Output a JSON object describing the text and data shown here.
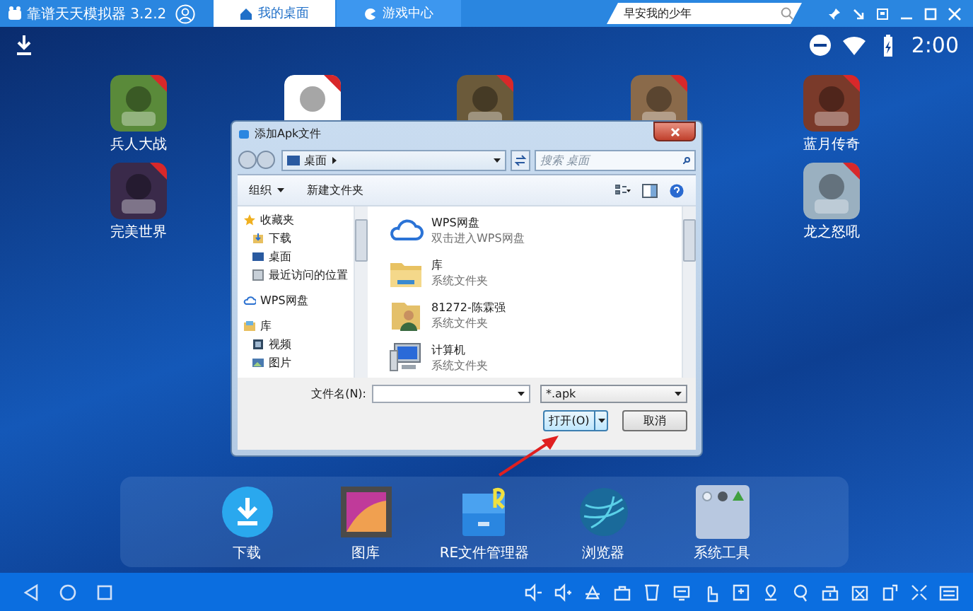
{
  "emulator": {
    "title": "靠谱天天模拟器 3.2.2",
    "tabs": [
      {
        "label": "我的桌面",
        "selected": true
      },
      {
        "label": "游戏中心",
        "selected": false
      }
    ],
    "search": {
      "value": "早安我的少年"
    }
  },
  "status_bar": {
    "time": "2:00"
  },
  "desktop_rows": [
    [
      {
        "label": "兵人大战"
      },
      {},
      {},
      {},
      {
        "label": "蓝月传奇"
      }
    ],
    [
      {
        "label": "完美世界"
      },
      {
        "label": "龙之怒吼"
      }
    ]
  ],
  "dialog": {
    "title": "添加Apk文件",
    "path": "桌面",
    "search_placeholder": "搜索 桌面",
    "toolbar": [
      "组织",
      "新建文件夹"
    ],
    "nav": [
      {
        "label": "收藏夹",
        "kind": "star",
        "children": [
          {
            "label": "下载",
            "kind": "download"
          },
          {
            "label": "桌面",
            "kind": "desktop"
          },
          {
            "label": "最近访问的位置",
            "kind": "recent"
          }
        ]
      },
      {
        "label": "WPS网盘",
        "kind": "cloud"
      },
      {
        "label": "库",
        "kind": "library",
        "children": [
          {
            "label": "视频",
            "kind": "video"
          },
          {
            "label": "图片",
            "kind": "picture"
          }
        ]
      }
    ],
    "files": [
      {
        "name": "WPS网盘",
        "type": "双击进入WPS网盘",
        "kind": "cloud"
      },
      {
        "name": "库",
        "type": "系统文件夹",
        "kind": "library"
      },
      {
        "name": "81272-陈霖强",
        "type": "系统文件夹",
        "kind": "user"
      },
      {
        "name": "计算机",
        "type": "系统文件夹",
        "kind": "computer"
      }
    ],
    "filename_label": "文件名(N):",
    "filter": "*.apk",
    "buttons": [
      {
        "label": "打开(O)",
        "kind": "split"
      },
      {
        "label": "取消",
        "kind": "plain"
      }
    ]
  },
  "dock": [
    {
      "label": "下载",
      "kind": "download"
    },
    {
      "label": "图库",
      "kind": "gallery"
    },
    {
      "label": "RE文件管理器",
      "kind": "files"
    },
    {
      "label": "浏览器",
      "kind": "browser"
    },
    {
      "label": "系统工具",
      "kind": "folder"
    }
  ]
}
